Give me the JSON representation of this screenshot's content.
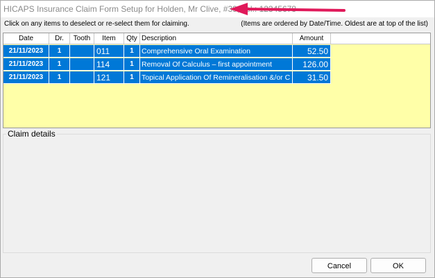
{
  "window": {
    "title": "HICAPS Insurance Claim Form Setup for Holden, Mr Clive, #39, Tel.: 12345678"
  },
  "instructions": {
    "left": "Click on any items to deselect or re-select them for claiming.",
    "right": "(Items are ordered by Date/Time. Oldest are at top of the list)"
  },
  "grid": {
    "columns": {
      "date": "Date",
      "dr": "Dr.",
      "tooth": "Tooth",
      "item": "Item",
      "qty": "Qty",
      "description": "Description",
      "amount": "Amount"
    },
    "rows": [
      {
        "date": "21/11/2023",
        "dr": "1",
        "tooth": "",
        "item": "011",
        "qty": "1",
        "description": "Comprehensive Oral Examination",
        "amount": "52.50"
      },
      {
        "date": "21/11/2023",
        "dr": "1",
        "tooth": "",
        "item": "114",
        "qty": "1",
        "description": "Removal Of Calculus – first appointment",
        "amount": "126.00"
      },
      {
        "date": "21/11/2023",
        "dr": "1",
        "tooth": "",
        "item": "121",
        "qty": "1",
        "description": "Topical Application Of Remineralisation &/or C",
        "amount": "31.50"
      }
    ]
  },
  "claim": {
    "label": "Claim details"
  },
  "buttons": {
    "cancel": "Cancel",
    "ok": "OK"
  },
  "colors": {
    "selection": "#0078d7",
    "grid_background": "#ffffa8",
    "annotation_arrow": "#e0195a"
  }
}
